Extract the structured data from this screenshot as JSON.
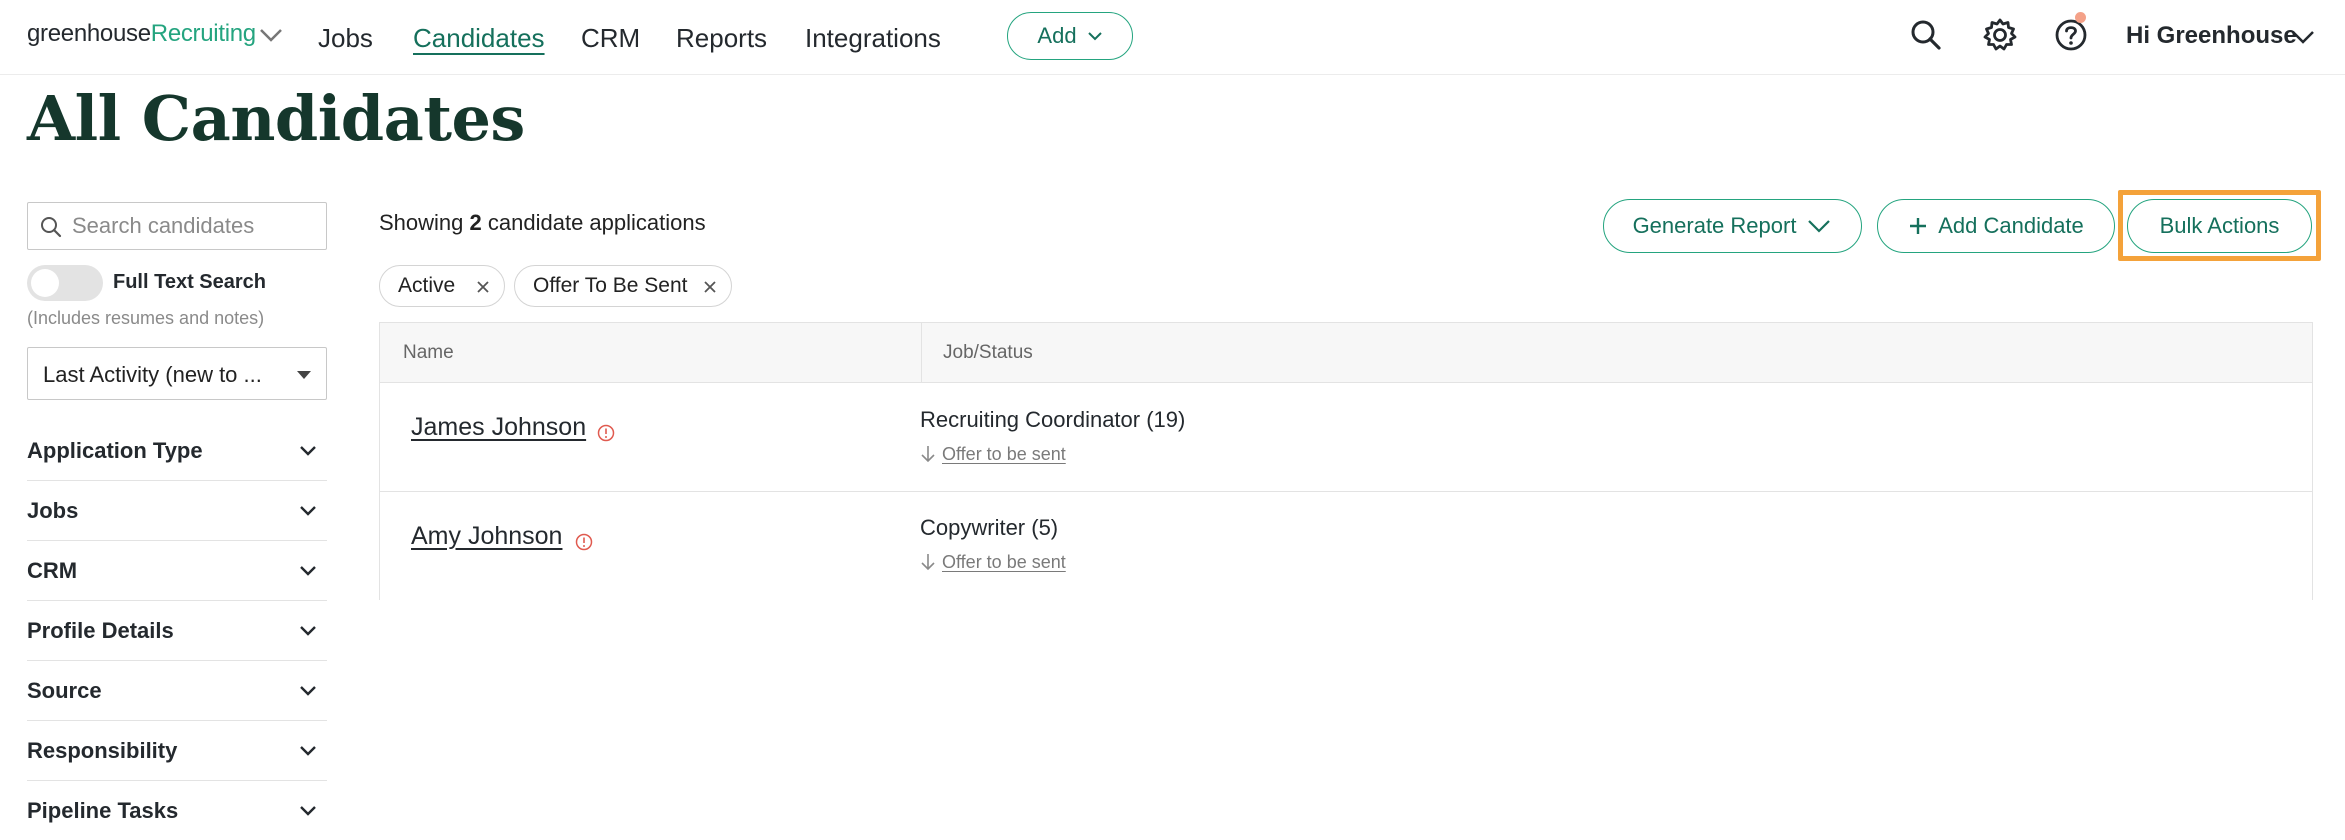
{
  "nav": {
    "logo_main": "greenhouse",
    "logo_accent": "Recruiting",
    "items": [
      "Jobs",
      "Candidates",
      "CRM",
      "Reports",
      "Integrations"
    ],
    "active": "Candidates",
    "add_label": "Add",
    "user_label": "Hi Greenhouse",
    "icons": [
      "search-icon",
      "gear-icon",
      "help-icon"
    ]
  },
  "page": {
    "title": "All Candidates"
  },
  "sidebar": {
    "search_placeholder": "Search candidates",
    "full_text_label": "Full Text Search",
    "full_text_note": "(Includes resumes and notes)",
    "full_text_enabled": false,
    "sort_value": "Last Activity (new to ...",
    "filters": [
      "Application Type",
      "Jobs",
      "CRM",
      "Profile Details",
      "Source",
      "Responsibility",
      "Pipeline Tasks"
    ]
  },
  "main": {
    "showing_prefix": "Showing",
    "showing_count": "2",
    "showing_suffix": "candidate applications",
    "generate_report_label": "Generate Report",
    "add_candidate_label": "Add Candidate",
    "bulk_actions_label": "Bulk Actions",
    "highlight_color": "#f4a23a",
    "chips": [
      "Active",
      "Offer To Be Sent"
    ],
    "columns": [
      "Name",
      "Job/Status"
    ],
    "rows": [
      {
        "name": "James Johnson",
        "job": "Recruiting Coordinator (19)",
        "status": "Offer to be sent"
      },
      {
        "name": "Amy Johnson",
        "job": "Copywriter (5)",
        "status": "Offer to be sent"
      }
    ]
  },
  "colors": {
    "brand": "#24a47f",
    "brand_dark": "#15705c",
    "title": "#15372c",
    "alert": "#e05a4f"
  }
}
